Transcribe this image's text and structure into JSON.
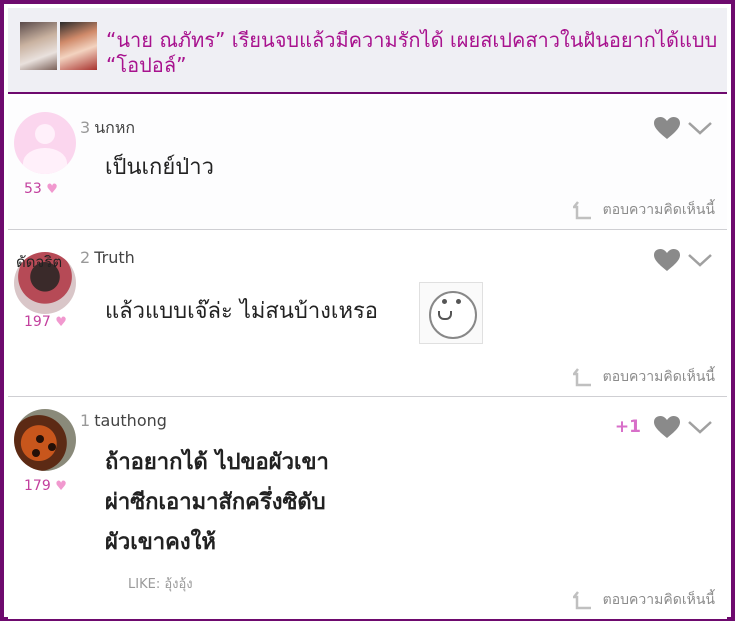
{
  "header": {
    "title": "“นาย ณภัทร” เรียนจบแล้วมีความรักได้ เผยสเปคสาวในฝันอยากได้แบบ “โอปอล์”"
  },
  "comments": [
    {
      "number": "3",
      "username": "นกหก",
      "likes": "53",
      "text": [
        "เป็นเกย์ป่าว"
      ],
      "reply_label": "ตอบความคิดเห็นนี้"
    },
    {
      "number": "2",
      "username": "Truth",
      "avatar_label": "ดัดจริต",
      "likes": "197",
      "text": [
        "แล้วแบบเจ๊ล่ะ ไม่สนบ้างเหรอ"
      ],
      "reply_label": "ตอบความคิดเห็นนี้"
    },
    {
      "number": "1",
      "username": "tauthong",
      "likes": "179",
      "plus": "+1",
      "text": [
        "ถ้าอยากได้ ไปขอผัวเขา",
        "ผ่าซีกเอามาสักครึ่งซิดับ",
        "ผัวเขาคงให้"
      ],
      "like_line": "LIKE: อุ้งอุ้ง",
      "reply_label": "ตอบความคิดเห็นนี้"
    }
  ],
  "colors": {
    "frame": "#6e0a6e",
    "title": "#a8128e",
    "likes": "#c3409e",
    "heart_small": "#f199cf",
    "plus": "#d86fc9",
    "heart_icon": "#8a8a8a"
  },
  "icons": [
    "heart-icon",
    "chevron-down-icon",
    "reply-arrow-icon",
    "small-heart-icon"
  ]
}
